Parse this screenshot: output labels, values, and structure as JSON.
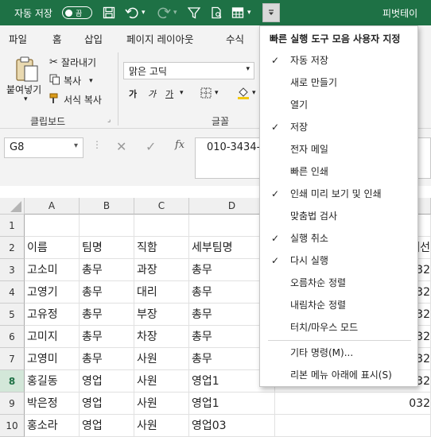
{
  "titlebar": {
    "autosave_label": "자동 저장",
    "autosave_toggle": "끔",
    "app_title": "피벗테이",
    "colors": {
      "bar": "#1e7145"
    }
  },
  "qat_icons": [
    "save-icon",
    "undo-icon",
    "undo-dropdown-icon",
    "redo-icon",
    "redo-dropdown-icon",
    "filter-icon",
    "print-preview-icon",
    "table-format-icon",
    "table-format-dropdown-icon"
  ],
  "tabs": [
    "파일",
    "홈",
    "삽입",
    "페이지 레이아웃",
    "수식"
  ],
  "active_tab": "홈",
  "ribbon": {
    "paste": "붙여넣기",
    "cut": "잘라내기",
    "copy": "복사",
    "format_painter": "서식 복사",
    "clipboard_group": "클립보드",
    "font_name": "맑은 고딕",
    "bold": "가",
    "italic": "가",
    "underline": "가",
    "font_group": "글꼴"
  },
  "formula_bar": {
    "name_box": "G8",
    "formula_value": "010-3434-",
    "fx": "fx"
  },
  "columns": [
    "A",
    "B",
    "C",
    "D"
  ],
  "rows": [
    {
      "num": "1",
      "cells": [
        "",
        "",
        "",
        ""
      ],
      "extra": ""
    },
    {
      "num": "2",
      "cells": [
        "이름",
        "팀명",
        "직함",
        "세부팀명"
      ],
      "extra": "내선"
    },
    {
      "num": "3",
      "cells": [
        "고소미",
        "총무",
        "과장",
        "총무"
      ],
      "extra": "032"
    },
    {
      "num": "4",
      "cells": [
        "고영기",
        "총무",
        "대리",
        "총무"
      ],
      "extra": "032"
    },
    {
      "num": "5",
      "cells": [
        "고유정",
        "총무",
        "부장",
        "총무"
      ],
      "extra": "032"
    },
    {
      "num": "6",
      "cells": [
        "고미지",
        "총무",
        "차장",
        "총무"
      ],
      "extra": "032"
    },
    {
      "num": "7",
      "cells": [
        "고영미",
        "총무",
        "사원",
        "총무"
      ],
      "extra": "032"
    },
    {
      "num": "8",
      "cells": [
        "홍길동",
        "영업",
        "사원",
        "영업1"
      ],
      "extra": "032"
    },
    {
      "num": "9",
      "cells": [
        "박은정",
        "영업",
        "사원",
        "영업1"
      ],
      "extra": "032"
    },
    {
      "num": "10",
      "cells": [
        "홍소라",
        "영업",
        "사원",
        "영업03"
      ],
      "extra": ""
    }
  ],
  "selected_row": "8",
  "qat_menu": {
    "title": "빠른 실행 도구 모음 사용자 지정",
    "items": [
      {
        "label": "자동 저장",
        "checked": true
      },
      {
        "label": "새로 만들기",
        "checked": false
      },
      {
        "label": "열기",
        "checked": false
      },
      {
        "label": "저장",
        "checked": true
      },
      {
        "label": "전자 메일",
        "checked": false
      },
      {
        "label": "빠른 인쇄",
        "checked": false
      },
      {
        "label": "인쇄 미리 보기 및 인쇄",
        "checked": true
      },
      {
        "label": "맞춤법 검사",
        "checked": false
      },
      {
        "label": "실행 취소",
        "checked": true
      },
      {
        "label": "다시 실행",
        "checked": true
      },
      {
        "label": "오름차순 정렬",
        "checked": false
      },
      {
        "label": "내림차순 정렬",
        "checked": false
      },
      {
        "label": "터치/마우스 모드",
        "checked": false
      }
    ],
    "more_commands": "기타 명령(M)...",
    "show_below": "리본 메뉴 아래에 표시(S)",
    "check_mark": "✓"
  }
}
